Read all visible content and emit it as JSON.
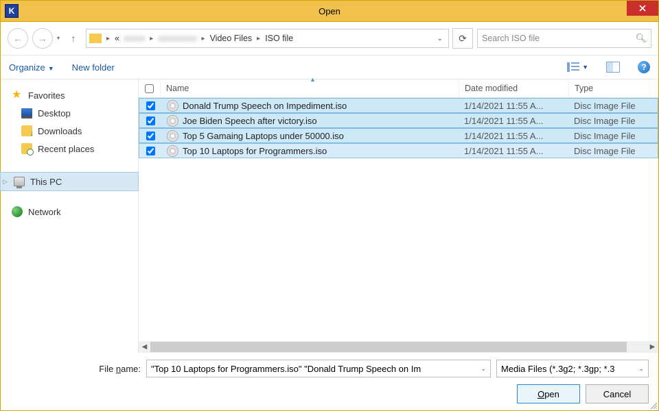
{
  "window": {
    "title": "Open"
  },
  "nav": {
    "breadcrumbs": [
      "«",
      "",
      "",
      "Video Files",
      "ISO file"
    ],
    "searchPlaceholder": "Search ISO file"
  },
  "toolbar": {
    "organize": "Organize",
    "newFolder": "New folder"
  },
  "sidebar": {
    "favoritesLabel": "Favorites",
    "favorites": [
      {
        "label": "Desktop",
        "icon": "desktop"
      },
      {
        "label": "Downloads",
        "icon": "downloads"
      },
      {
        "label": "Recent places",
        "icon": "recent"
      }
    ],
    "thisPC": "This PC",
    "network": "Network"
  },
  "columns": {
    "name": "Name",
    "date": "Date modified",
    "type": "Type"
  },
  "files": [
    {
      "checked": true,
      "name": "Donald Trump Speech on Impediment.iso",
      "date": "1/14/2021 11:55 A...",
      "type": "Disc Image File",
      "sel": "selected"
    },
    {
      "checked": true,
      "name": "Joe Biden Speech after victory.iso",
      "date": "1/14/2021 11:55 A...",
      "type": "Disc Image File",
      "sel": "selected"
    },
    {
      "checked": true,
      "name": "Top 5 Gamaing Laptops under 50000.iso",
      "date": "1/14/2021 11:55 A...",
      "type": "Disc Image File",
      "sel": "selected"
    },
    {
      "checked": true,
      "name": "Top 10 Laptops for Programmers.iso",
      "date": "1/14/2021 11:55 A...",
      "type": "Disc Image File",
      "sel": "selected-focus"
    }
  ],
  "footer": {
    "fileNameLabel": "File name:",
    "fileNameValue": "\"Top 10 Laptops for Programmers.iso\" \"Donald Trump Speech on Im",
    "filterValue": "Media Files (*.3g2; *.3gp; *.3",
    "openLabelPre": "O",
    "openLabelPost": "pen",
    "cancelLabel": "Cancel"
  }
}
